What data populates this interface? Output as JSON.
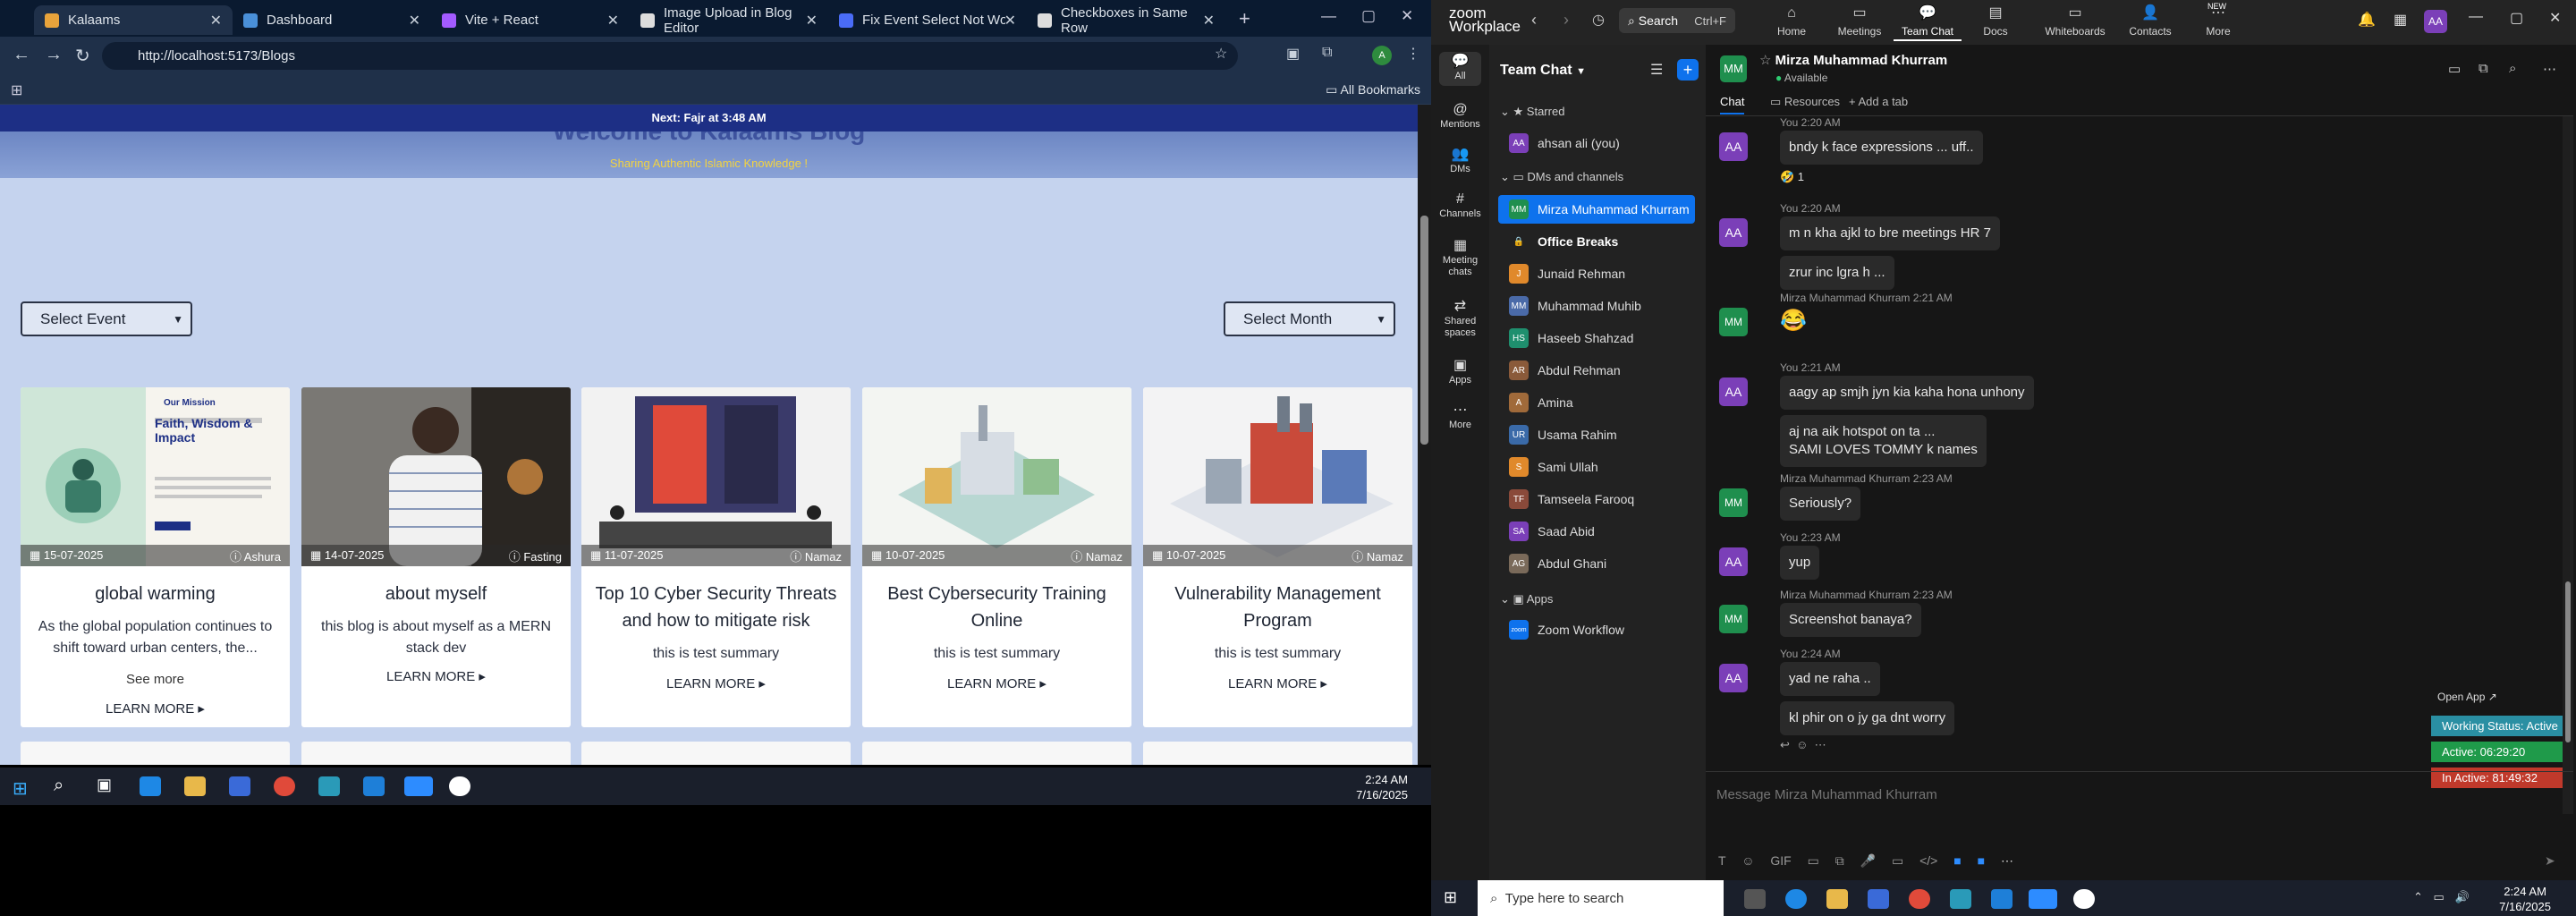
{
  "browser": {
    "tabs": [
      {
        "label": "Kalaams",
        "color": "#e8a33b"
      },
      {
        "label": "Dashboard",
        "color": "#4a90d9"
      },
      {
        "label": "Vite + React",
        "color": "#a35bff"
      },
      {
        "label": "Image Upload in Blog Editor",
        "color": "#dddddd"
      },
      {
        "label": "Fix Event Select Not Working",
        "color": "#4a6cf7"
      },
      {
        "label": "Checkboxes in Same Row",
        "color": "#dddddd"
      }
    ],
    "url": "http://localhost:5173/Blogs",
    "bookmarks_label": "All Bookmarks"
  },
  "page": {
    "prayer": "Next: Fajr at 3:48 AM",
    "title": "Welcome to Kalaams Blog",
    "subtitle": "Sharing Authentic Islamic Knowledge !",
    "select_event": "Select Event",
    "select_month": "Select Month",
    "cards": [
      {
        "date": "15-07-2025",
        "category": "Ashura",
        "title": "global warming",
        "summary": "As the global population continues to shift toward urban centers, the...",
        "see_more": "See more",
        "learn_more": "LEARN MORE ▸"
      },
      {
        "date": "14-07-2025",
        "category": "Fasting",
        "title": "about myself",
        "summary": "this blog is about myself as a MERN stack dev",
        "learn_more": "LEARN MORE ▸"
      },
      {
        "date": "11-07-2025",
        "category": "Namaz",
        "title": "Top 10 Cyber Security Threats and how to mitigate risk",
        "summary": "this is test summary",
        "learn_more": "LEARN MORE ▸"
      },
      {
        "date": "10-07-2025",
        "category": "Namaz",
        "title": "Best Cybersecurity Training Online",
        "summary": "this is test summary",
        "learn_more": "LEARN MORE ▸"
      },
      {
        "date": "10-07-2025",
        "category": "Namaz",
        "title": "Vulnerability Management Program",
        "summary": "this is test summary",
        "learn_more": "LEARN MORE ▸"
      }
    ],
    "card1_thumb": {
      "heading": "Our Mission",
      "title": "Faith, Wisdom & Impact"
    }
  },
  "taskbar_left": {
    "time": "2:24 AM",
    "date": "7/16/2025"
  },
  "zoom": {
    "brand": "zoom Workplace",
    "search": "Search",
    "search_key": "Ctrl+F",
    "nav": [
      {
        "label": "Home",
        "glyph": "⌂"
      },
      {
        "label": "Meetings",
        "glyph": "▭"
      },
      {
        "label": "Team Chat",
        "glyph": "💬"
      },
      {
        "label": "Docs",
        "glyph": "▤"
      },
      {
        "label": "Whiteboards",
        "glyph": "▭"
      },
      {
        "label": "Contacts",
        "glyph": "👤"
      },
      {
        "label": "More",
        "glyph": "⋯"
      }
    ],
    "new_badge": "NEW",
    "user_initials": "AA",
    "rail": [
      {
        "label": "All",
        "glyph": "💬"
      },
      {
        "label": "Mentions",
        "glyph": "@"
      },
      {
        "label": "DMs",
        "glyph": "👥"
      },
      {
        "label": "Channels",
        "glyph": "#"
      },
      {
        "label": "Meeting chats",
        "glyph": "▦"
      },
      {
        "label": "Shared spaces",
        "glyph": "⇄"
      },
      {
        "label": "Apps",
        "glyph": "▣"
      },
      {
        "label": "More",
        "glyph": "⋯"
      }
    ],
    "panel_title": "Team Chat",
    "starred": "Starred",
    "starred_items": [
      {
        "name": "ahsan ali (you)",
        "initials": "AA",
        "color": "#7b3fb8"
      }
    ],
    "dms_title": "DMs and channels",
    "dms": [
      {
        "name": "Mirza Muhammad Khurram",
        "initials": "MM",
        "color": "#1f8f4e"
      },
      {
        "name": "Office Breaks",
        "initials": "🔒",
        "color": "#333333"
      },
      {
        "name": "Junaid Rehman",
        "initials": "J",
        "color": "#e0892b"
      },
      {
        "name": "Muhammad Muhib",
        "initials": "MM",
        "color": "#4a6aa8"
      },
      {
        "name": "Haseeb Shahzad",
        "initials": "HS",
        "color": "#1f8f6e"
      },
      {
        "name": "Abdul Rehman",
        "initials": "AR",
        "color": "#8a5a3a"
      },
      {
        "name": "Amina",
        "initials": "A",
        "color": "#a06a3a"
      },
      {
        "name": "Usama Rahim",
        "initials": "UR",
        "color": "#3a6aa8"
      },
      {
        "name": "Sami Ullah",
        "initials": "S",
        "color": "#e0892b"
      },
      {
        "name": "Tamseela Farooq",
        "initials": "TF",
        "color": "#8a4a3a"
      },
      {
        "name": "Saad Abid",
        "initials": "SA",
        "color": "#7b3fb8"
      },
      {
        "name": "Abdul Ghani",
        "initials": "AG",
        "color": "#7a6a5a"
      }
    ],
    "apps_title": "Apps",
    "apps": [
      {
        "name": "Zoom Workflow",
        "initials": "zoom",
        "color": "#0e72ed"
      }
    ],
    "chat_name": "Mirza Muhammad Khurram",
    "chat_status": "Available",
    "chat_initials": "MM",
    "chat_tabs": {
      "chat": "Chat",
      "resources": "Resources",
      "add": "+ Add a tab"
    },
    "messages": [
      {
        "who": "AA",
        "time": "You 2:20 AM",
        "text": "bndy k face expressions ... uff.."
      },
      {
        "who": "AA",
        "time": "You 2:20 AM",
        "text": "m n kha ajkl to bre meetings HR 7"
      },
      {
        "who": "AA",
        "time": "",
        "text": "zrur inc lgra h ..."
      },
      {
        "who": "MM",
        "time": "Mirza Muhammad Khurram 2:21 AM",
        "text": "😂"
      },
      {
        "who": "AA",
        "time": "You 2:21 AM",
        "text": "aagy ap smjh jyn kia kaha hona unhony"
      },
      {
        "who": "AA",
        "time": "",
        "text": "aj na aik hotspot on ta ..."
      },
      {
        "who": "AA",
        "time": "",
        "text": "SAMI LOVES TOMMY k names"
      },
      {
        "who": "MM",
        "time": "Mirza Muhammad Khurram 2:23 AM",
        "text": "Seriously?"
      },
      {
        "who": "AA",
        "time": "You 2:23 AM",
        "text": "yup"
      },
      {
        "who": "MM",
        "time": "Mirza Muhammad Khurram 2:23 AM",
        "text": "Screenshot banaya?"
      },
      {
        "who": "AA",
        "time": "You 2:24 AM",
        "text": "yad ne raha .."
      },
      {
        "who": "AA",
        "time": "",
        "text": "kl phir on o  jy ga dnt worry"
      }
    ],
    "reaction": "🤣 1",
    "compose_placeholder": "Message Mirza Muhammad Khurram",
    "open_app": "Open App",
    "working": {
      "status": "Working Status: Active",
      "active": "Active: 06:29:20",
      "inactive": "In Active: 81:49:32"
    }
  },
  "taskbar_right": {
    "search": "Type here to search",
    "time": "2:24 AM",
    "date": "7/16/2025"
  }
}
